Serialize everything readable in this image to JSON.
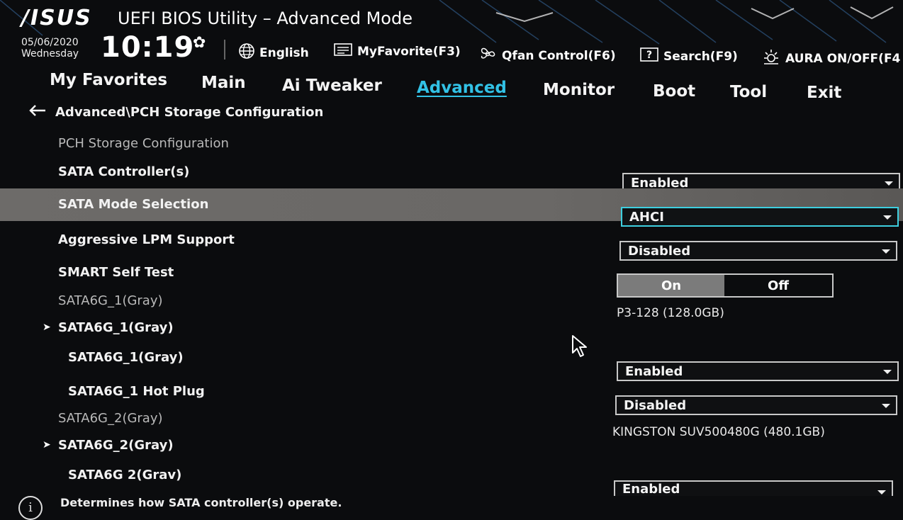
{
  "header": {
    "logo": "/ISUS",
    "title": "UEFI BIOS Utility – Advanced Mode",
    "date": "05/06/2020",
    "weekday": "Wednesday",
    "time": "10:19",
    "tools": [
      {
        "icon": "globe-icon",
        "label": "English"
      },
      {
        "icon": "favorite-icon",
        "label": "MyFavorite(F3)"
      },
      {
        "icon": "fan-icon",
        "label": "Qfan Control(F6)"
      },
      {
        "icon": "search-icon",
        "label": "Search(F9)"
      },
      {
        "icon": "aura-icon",
        "label": "AURA ON/OFF(F4"
      }
    ]
  },
  "tabs": [
    "My Favorites",
    "Main",
    "Ai Tweaker",
    "Advanced",
    "Monitor",
    "Boot",
    "Tool",
    "Exit"
  ],
  "active_tab": "Advanced",
  "breadcrumb": "Advanced\\PCH Storage Configuration",
  "rows": [
    {
      "label": "PCH Storage Configuration"
    },
    {
      "label": "SATA Controller(s)",
      "value": "Enabled"
    },
    {
      "label": "SATA Mode Selection",
      "value": "AHCI"
    },
    {
      "label": "Aggressive LPM Support",
      "value": "Disabled"
    },
    {
      "label": "SMART Self Test",
      "on": "On",
      "off": "Off"
    },
    {
      "label": "SATA6G_1(Gray)",
      "device": "P3-128 (128.0GB)"
    },
    {
      "label": "SATA6G_1(Gray)"
    },
    {
      "label": "SATA6G_1(Gray)",
      "value": "Enabled"
    },
    {
      "label": "SATA6G_1 Hot Plug",
      "value": "Disabled"
    },
    {
      "label": "SATA6G_2(Gray)",
      "device": "KINGSTON SUV500480G (480.1GB)"
    },
    {
      "label": "SATA6G_2(Gray)"
    },
    {
      "label": "SATA6G 2(Grav)",
      "value": "Enabled"
    }
  ],
  "help_text": "Determines how SATA controller(s) operate.",
  "colors": {
    "accent": "#32c2e6",
    "highlight": "#6d6b69",
    "background": "#0b0c0e"
  }
}
